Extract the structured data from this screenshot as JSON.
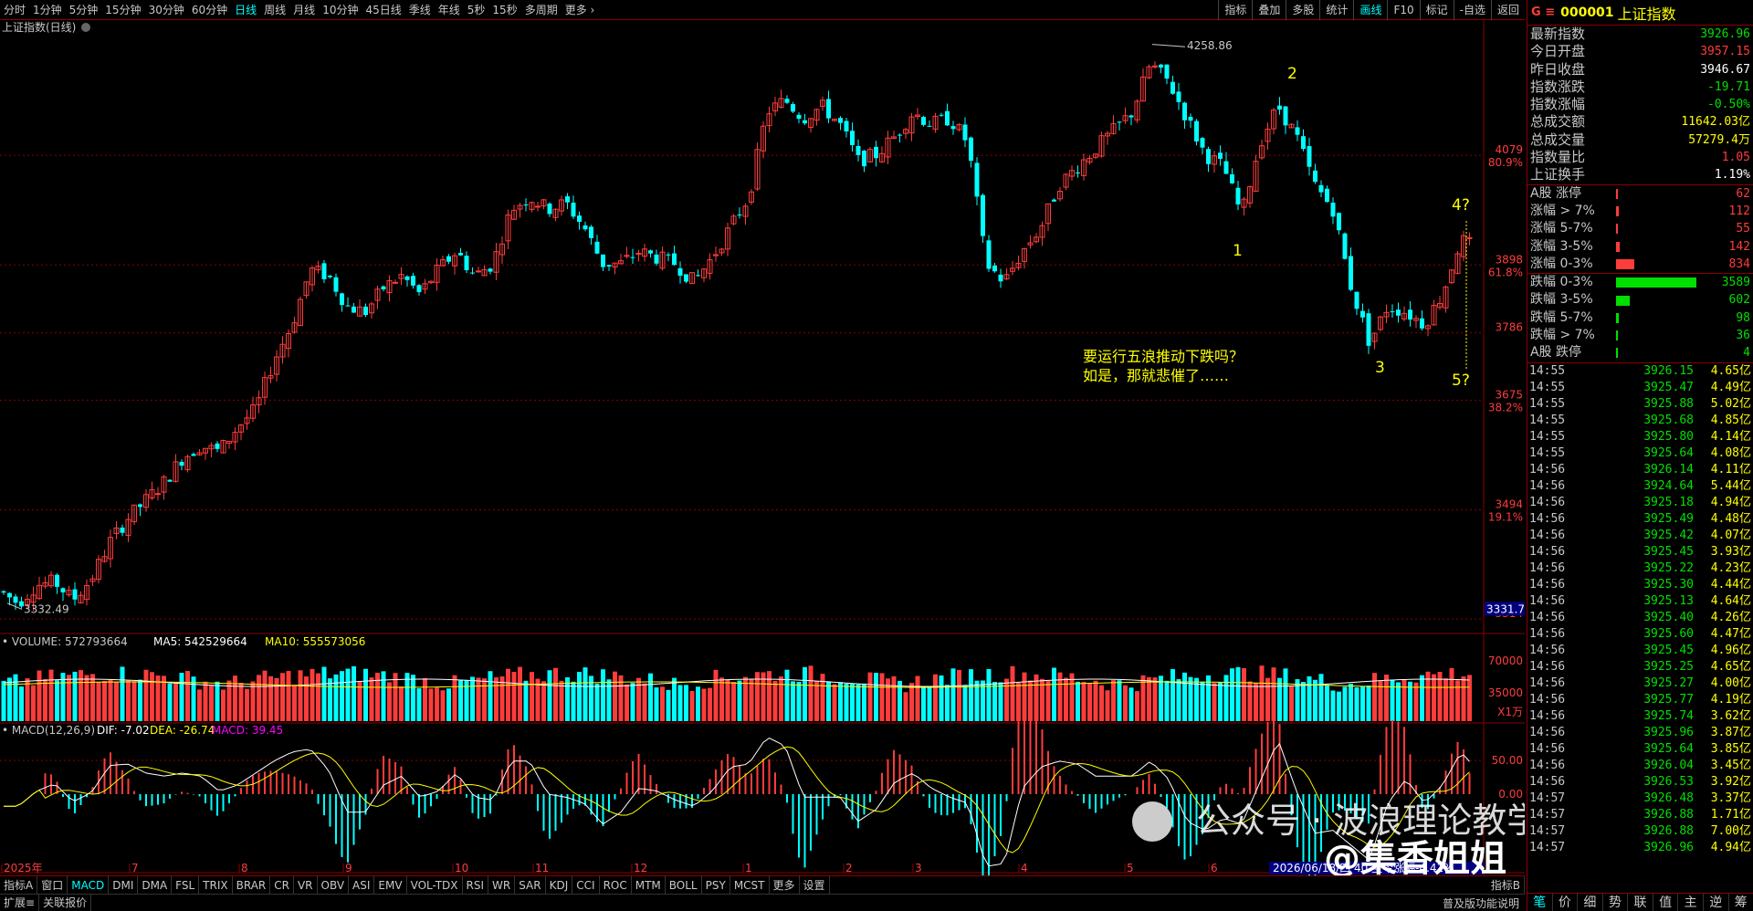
{
  "periods": [
    "分时",
    "1分钟",
    "5分钟",
    "15分钟",
    "30分钟",
    "60分钟",
    "日线",
    "周线",
    "月线",
    "10分钟",
    "45日线",
    "季线",
    "年线",
    "5秒",
    "15秒",
    "多周期",
    "更多 ›"
  ],
  "active_period": "日线",
  "tools": [
    "指标",
    "叠加",
    "多股",
    "统计",
    "画线",
    "F10",
    "标记",
    "-自选",
    "返回"
  ],
  "active_tool": "画线",
  "chart": {
    "title": "上证指数(日线)",
    "price_axis": [
      {
        "v": "4079",
        "p": "80.9%"
      },
      {
        "v": "3898",
        "p": "61.8%"
      },
      {
        "v": "3786",
        "p": ""
      },
      {
        "v": "3675",
        "p": "38.2%"
      },
      {
        "v": "3494",
        "p": "19.1%"
      },
      {
        "v": "3314",
        "p": ""
      }
    ],
    "cursor_price": "3331.7",
    "high_label": "4258.86",
    "low_label": "3332.49",
    "wave_labels": [
      "1",
      "2",
      "3",
      "4?",
      "5?"
    ],
    "annotation_line1": "要运行五浪推动下跌吗？",
    "annotation_line2": "如是，那就悲催了……",
    "volume_header": {
      "vol": "VOLUME: 572793664",
      "ma5": "MA5: 542529664",
      "ma10": "MA10: 555573056"
    },
    "volume_axis": [
      "70000",
      "35000",
      "X1万"
    ],
    "macd_header": {
      "name": "MACD(12,26,9)",
      "dif": "DIF: -7.02",
      "dea": "DEA: -26.74",
      "macd": "MACD: 39.45"
    },
    "macd_axis": [
      "50.00",
      "0.00"
    ],
    "month_labels": [
      "2025年",
      "7",
      "8",
      "9",
      "10",
      "11",
      "12",
      "1",
      "2",
      "3",
      "4",
      "5",
      "6"
    ],
    "date_status": "2026/06/18/四 40 至今涨幅-4.41%",
    "watermark1": "公众号 · 波浪理论教学",
    "watermark2": "@集香姐姐"
  },
  "indicator_tabs": [
    "指标A",
    "窗口",
    "MACD",
    "DMI",
    "DMA",
    "FSL",
    "TRIX",
    "BRAR",
    "CR",
    "VR",
    "OBV",
    "ASI",
    "EMV",
    "VOL-TDX",
    "RSI",
    "WR",
    "SAR",
    "KDJ",
    "CCI",
    "ROC",
    "MTM",
    "BOLL",
    "PSY",
    "MCST",
    "更多",
    "设置"
  ],
  "active_indicator": "MACD",
  "bottom_left": [
    "扩展≡",
    "关联报价"
  ],
  "bottom_right_label": "指标B",
  "bottom_right_label2": "普及版功能说明",
  "stock": {
    "g": "G ≡",
    "code": "000001",
    "name": "上证指数"
  },
  "quotes": [
    {
      "label": "最新指数",
      "value": "3926.96",
      "color": "#00e000"
    },
    {
      "label": "今日开盘",
      "value": "3957.15",
      "color": "#ff3c3c"
    },
    {
      "label": "昨日收盘",
      "value": "3946.67",
      "color": "#ffffff"
    },
    {
      "label": "指数涨跌",
      "value": "-19.71",
      "color": "#00e000"
    },
    {
      "label": "指数涨幅",
      "value": "-0.50%",
      "color": "#00e000"
    },
    {
      "label": "总成交额",
      "value": "11642.03亿",
      "color": "#ffff00"
    },
    {
      "label": "总成交量",
      "value": "57279.4万",
      "color": "#ffff00"
    },
    {
      "label": "指数量比",
      "value": "1.05",
      "color": "#ff3c3c"
    },
    {
      "label": "上证换手",
      "value": "1.19%",
      "color": "#ffffff"
    }
  ],
  "breadth_up": [
    {
      "label": "A股 涨停",
      "value": "62",
      "frac": 0.02
    },
    {
      "label": "涨幅 > 7%",
      "value": "112",
      "frac": 0.03
    },
    {
      "label": "涨幅 5-7%",
      "value": "55",
      "frac": 0.02
    },
    {
      "label": "涨幅 3-5%",
      "value": "142",
      "frac": 0.04
    },
    {
      "label": "涨幅 0-3%",
      "value": "834",
      "frac": 0.23
    }
  ],
  "breadth_down": [
    {
      "label": "跌幅 0-3%",
      "value": "3589",
      "frac": 1.0
    },
    {
      "label": "跌幅 3-5%",
      "value": "602",
      "frac": 0.17
    },
    {
      "label": "跌幅 5-7%",
      "value": "98",
      "frac": 0.03
    },
    {
      "label": "跌幅 > 7%",
      "value": "36",
      "frac": 0.01
    },
    {
      "label": "A股 跌停",
      "value": "4",
      "frac": 0.005
    }
  ],
  "ticks": [
    [
      "14:55",
      "3926.15",
      "4.65亿"
    ],
    [
      "14:55",
      "3925.47",
      "4.49亿"
    ],
    [
      "14:55",
      "3925.88",
      "5.02亿"
    ],
    [
      "14:55",
      "3925.68",
      "4.85亿"
    ],
    [
      "14:55",
      "3925.80",
      "4.14亿"
    ],
    [
      "14:55",
      "3925.64",
      "4.08亿"
    ],
    [
      "14:56",
      "3926.14",
      "4.11亿"
    ],
    [
      "14:56",
      "3924.64",
      "5.44亿"
    ],
    [
      "14:56",
      "3925.18",
      "4.94亿"
    ],
    [
      "14:56",
      "3925.49",
      "4.48亿"
    ],
    [
      "14:56",
      "3925.42",
      "4.07亿"
    ],
    [
      "14:56",
      "3925.45",
      "3.93亿"
    ],
    [
      "14:56",
      "3925.22",
      "4.23亿"
    ],
    [
      "14:56",
      "3925.30",
      "4.44亿"
    ],
    [
      "14:56",
      "3925.13",
      "4.64亿"
    ],
    [
      "14:56",
      "3925.40",
      "4.26亿"
    ],
    [
      "14:56",
      "3925.60",
      "4.47亿"
    ],
    [
      "14:56",
      "3925.45",
      "4.96亿"
    ],
    [
      "14:56",
      "3925.25",
      "4.65亿"
    ],
    [
      "14:56",
      "3925.27",
      "4.00亿"
    ],
    [
      "14:56",
      "3925.77",
      "4.19亿"
    ],
    [
      "14:56",
      "3925.74",
      "3.62亿"
    ],
    [
      "14:56",
      "3925.96",
      "3.87亿"
    ],
    [
      "14:56",
      "3925.64",
      "3.85亿"
    ],
    [
      "14:56",
      "3926.04",
      "3.45亿"
    ],
    [
      "14:56",
      "3926.53",
      "3.92亿"
    ],
    [
      "14:57",
      "3926.48",
      "3.37亿"
    ],
    [
      "14:57",
      "3926.88",
      "1.71亿"
    ],
    [
      "14:57",
      "3926.88",
      "7.00亿"
    ],
    [
      "14:57",
      "3926.96",
      "4.94亿"
    ]
  ],
  "rp_tabs": [
    "笔",
    "价",
    "细",
    "势",
    "联",
    "值",
    "主",
    "逆",
    "筹"
  ],
  "active_rp": "笔"
}
